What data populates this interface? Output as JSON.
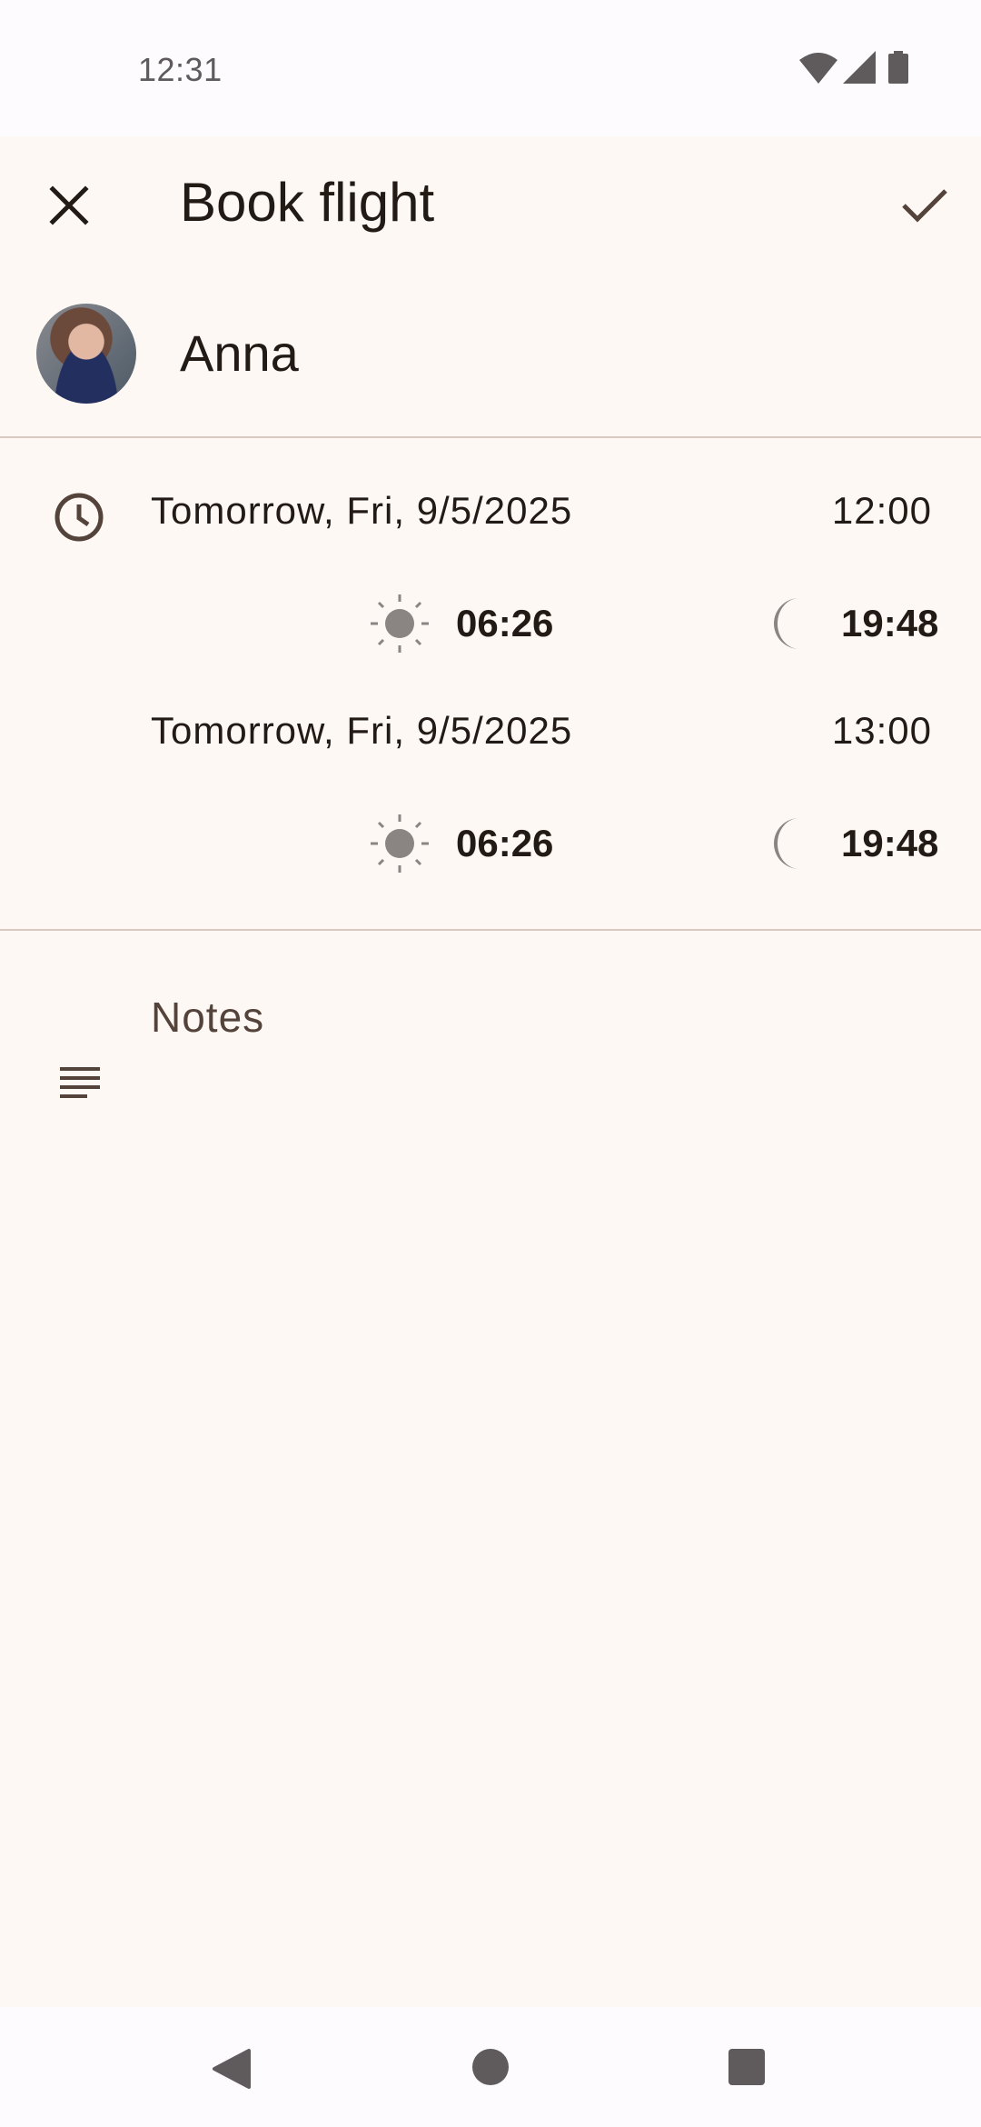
{
  "status_bar": {
    "time": "12:31",
    "icons": [
      "wifi-icon",
      "signal-icon",
      "battery-icon"
    ]
  },
  "toolbar": {
    "title": "Book flight",
    "close_icon": "close-icon",
    "save_icon": "check-icon"
  },
  "account": {
    "name": "Anna"
  },
  "events": [
    {
      "date": "Tomorrow, Fri, 9/5/2025",
      "time": "12:00",
      "sunrise": "06:26",
      "sunset": "19:48"
    },
    {
      "date": "Tomorrow, Fri, 9/5/2025",
      "time": "13:00",
      "sunrise": "06:26",
      "sunset": "19:48"
    }
  ],
  "notes": {
    "label": "Notes"
  },
  "colors": {
    "background": "#fef8f5",
    "text": "#221a15",
    "icon": "#53433a",
    "divider": "#d8c9c0",
    "weather_icon": "#8a8583"
  }
}
